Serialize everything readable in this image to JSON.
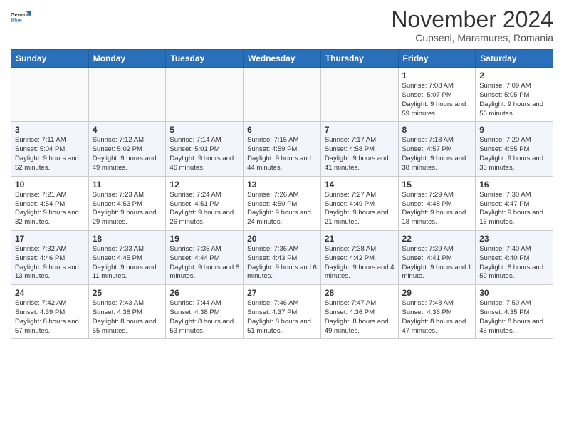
{
  "logo": {
    "general": "General",
    "blue": "Blue"
  },
  "title": "November 2024",
  "subtitle": "Cupseni, Maramures, Romania",
  "headers": [
    "Sunday",
    "Monday",
    "Tuesday",
    "Wednesday",
    "Thursday",
    "Friday",
    "Saturday"
  ],
  "weeks": [
    [
      {
        "day": "",
        "empty": true
      },
      {
        "day": "",
        "empty": true
      },
      {
        "day": "",
        "empty": true
      },
      {
        "day": "",
        "empty": true
      },
      {
        "day": "",
        "empty": true
      },
      {
        "day": "1",
        "sunrise": "7:08 AM",
        "sunset": "5:07 PM",
        "daylight": "9 hours and 59 minutes."
      },
      {
        "day": "2",
        "sunrise": "7:09 AM",
        "sunset": "5:05 PM",
        "daylight": "9 hours and 56 minutes."
      }
    ],
    [
      {
        "day": "3",
        "sunrise": "7:11 AM",
        "sunset": "5:04 PM",
        "daylight": "9 hours and 52 minutes."
      },
      {
        "day": "4",
        "sunrise": "7:12 AM",
        "sunset": "5:02 PM",
        "daylight": "9 hours and 49 minutes."
      },
      {
        "day": "5",
        "sunrise": "7:14 AM",
        "sunset": "5:01 PM",
        "daylight": "9 hours and 46 minutes."
      },
      {
        "day": "6",
        "sunrise": "7:15 AM",
        "sunset": "4:59 PM",
        "daylight": "9 hours and 44 minutes."
      },
      {
        "day": "7",
        "sunrise": "7:17 AM",
        "sunset": "4:58 PM",
        "daylight": "9 hours and 41 minutes."
      },
      {
        "day": "8",
        "sunrise": "7:18 AM",
        "sunset": "4:57 PM",
        "daylight": "9 hours and 38 minutes."
      },
      {
        "day": "9",
        "sunrise": "7:20 AM",
        "sunset": "4:55 PM",
        "daylight": "9 hours and 35 minutes."
      }
    ],
    [
      {
        "day": "10",
        "sunrise": "7:21 AM",
        "sunset": "4:54 PM",
        "daylight": "9 hours and 32 minutes."
      },
      {
        "day": "11",
        "sunrise": "7:23 AM",
        "sunset": "4:53 PM",
        "daylight": "9 hours and 29 minutes."
      },
      {
        "day": "12",
        "sunrise": "7:24 AM",
        "sunset": "4:51 PM",
        "daylight": "9 hours and 26 minutes."
      },
      {
        "day": "13",
        "sunrise": "7:26 AM",
        "sunset": "4:50 PM",
        "daylight": "9 hours and 24 minutes."
      },
      {
        "day": "14",
        "sunrise": "7:27 AM",
        "sunset": "4:49 PM",
        "daylight": "9 hours and 21 minutes."
      },
      {
        "day": "15",
        "sunrise": "7:29 AM",
        "sunset": "4:48 PM",
        "daylight": "9 hours and 18 minutes."
      },
      {
        "day": "16",
        "sunrise": "7:30 AM",
        "sunset": "4:47 PM",
        "daylight": "9 hours and 16 minutes."
      }
    ],
    [
      {
        "day": "17",
        "sunrise": "7:32 AM",
        "sunset": "4:46 PM",
        "daylight": "9 hours and 13 minutes."
      },
      {
        "day": "18",
        "sunrise": "7:33 AM",
        "sunset": "4:45 PM",
        "daylight": "9 hours and 11 minutes."
      },
      {
        "day": "19",
        "sunrise": "7:35 AM",
        "sunset": "4:44 PM",
        "daylight": "9 hours and 8 minutes."
      },
      {
        "day": "20",
        "sunrise": "7:36 AM",
        "sunset": "4:43 PM",
        "daylight": "9 hours and 6 minutes."
      },
      {
        "day": "21",
        "sunrise": "7:38 AM",
        "sunset": "4:42 PM",
        "daylight": "9 hours and 4 minutes."
      },
      {
        "day": "22",
        "sunrise": "7:39 AM",
        "sunset": "4:41 PM",
        "daylight": "9 hours and 1 minute."
      },
      {
        "day": "23",
        "sunrise": "7:40 AM",
        "sunset": "4:40 PM",
        "daylight": "8 hours and 59 minutes."
      }
    ],
    [
      {
        "day": "24",
        "sunrise": "7:42 AM",
        "sunset": "4:39 PM",
        "daylight": "8 hours and 57 minutes."
      },
      {
        "day": "25",
        "sunrise": "7:43 AM",
        "sunset": "4:38 PM",
        "daylight": "8 hours and 55 minutes."
      },
      {
        "day": "26",
        "sunrise": "7:44 AM",
        "sunset": "4:38 PM",
        "daylight": "8 hours and 53 minutes."
      },
      {
        "day": "27",
        "sunrise": "7:46 AM",
        "sunset": "4:37 PM",
        "daylight": "8 hours and 51 minutes."
      },
      {
        "day": "28",
        "sunrise": "7:47 AM",
        "sunset": "4:36 PM",
        "daylight": "8 hours and 49 minutes."
      },
      {
        "day": "29",
        "sunrise": "7:48 AM",
        "sunset": "4:36 PM",
        "daylight": "8 hours and 47 minutes."
      },
      {
        "day": "30",
        "sunrise": "7:50 AM",
        "sunset": "4:35 PM",
        "daylight": "8 hours and 45 minutes."
      }
    ]
  ]
}
